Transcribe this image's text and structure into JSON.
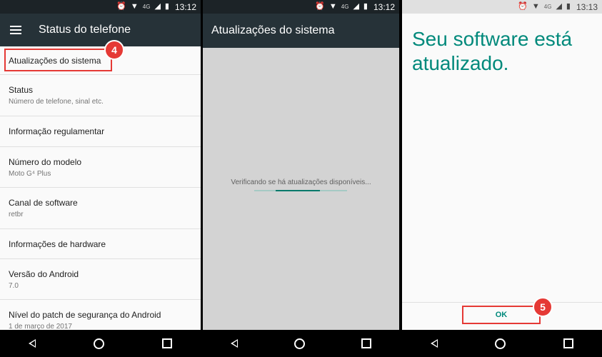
{
  "status_bar": {
    "network": "4G",
    "time_1": "13:12",
    "time_2": "13:12",
    "time_3": "13:13"
  },
  "screen1": {
    "title": "Status do telefone",
    "items": [
      {
        "title": "Atualizações do sistema",
        "subtitle": ""
      },
      {
        "title": "Status",
        "subtitle": "Número de telefone, sinal etc."
      },
      {
        "title": "Informação regulamentar",
        "subtitle": ""
      },
      {
        "title": "Número do modelo",
        "subtitle": "Moto G⁴ Plus"
      },
      {
        "title": "Canal de software",
        "subtitle": "retbr"
      },
      {
        "title": "Informações de hardware",
        "subtitle": ""
      },
      {
        "title": "Versão do Android",
        "subtitle": "7.0"
      },
      {
        "title": "Nível do patch de segurança do Android",
        "subtitle": "1 de março de 2017"
      }
    ],
    "badge": "4"
  },
  "screen2": {
    "title": "Atualizações do sistema",
    "checking_text": "Verificando se há atualizações disponíveis..."
  },
  "screen3": {
    "message": "Seu software está atualizado.",
    "ok_label": "OK",
    "badge": "5"
  },
  "colors": {
    "toolbar": "#263238",
    "accent": "#00897b",
    "highlight": "#e53935"
  }
}
